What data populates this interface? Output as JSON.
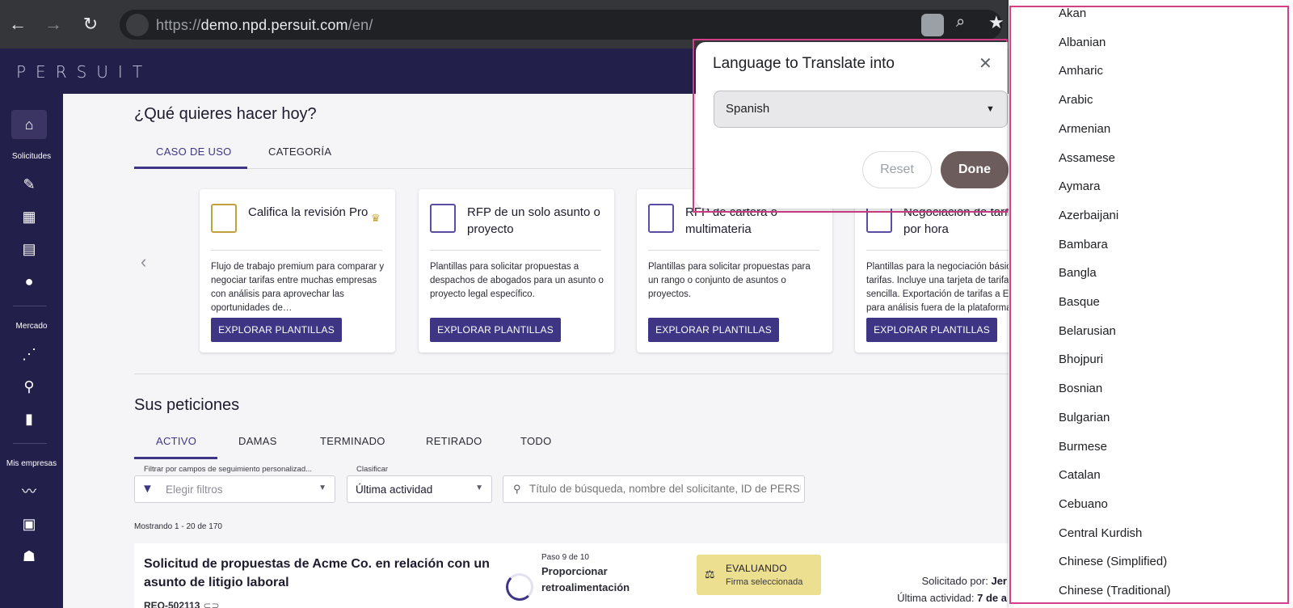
{
  "browser": {
    "url_scheme": "https://",
    "url_host": "demo.npd.persuit.com",
    "url_path": "/en/",
    "back_glyph": "←",
    "forward_glyph": "→",
    "reload_glyph": "↻"
  },
  "app": {
    "logo": "PERSUIT"
  },
  "sidebar": {
    "section_requests": "Solicitudes",
    "section_market": "Mercado",
    "section_firms": "Mis empresas"
  },
  "main": {
    "heading": "¿Qué quieres hacer hoy?",
    "tabs": [
      "CASO DE USO",
      "CATEGORÍA"
    ],
    "cards": [
      {
        "title": "Califica la revisión Pro",
        "desc": "Flujo de trabajo premium para comparar y negociar tarifas entre muchas empresas con análisis para aprovechar las oportunidades de…",
        "button": "EXPLORAR PLANTILLAS"
      },
      {
        "title": "RFP de un solo asunto o proyecto",
        "desc": "Plantillas para solicitar propuestas a despachos de abogados para un asunto o proyecto legal específico.",
        "button": "EXPLORAR PLANTILLAS"
      },
      {
        "title": "RFP de cartera o multimateria",
        "desc": "Plantillas para solicitar propuestas para un rango o conjunto de asuntos o proyectos.",
        "button": "EXPLORAR PLANTILLAS"
      },
      {
        "title": "Negociación de tarifas por hora",
        "desc": "Plantillas para la negociación básica de tarifas. Incluye una tarjeta de tarifas sencilla. Exportación de tarifas a Excel para análisis fuera de la plataforma.",
        "button": "EXPLORAR PLANTILLAS"
      }
    ],
    "requests_heading": "Sus peticiones",
    "request_tabs": [
      "ACTIVO",
      "DAMAS",
      "TERMINADO",
      "RETIRADO",
      "TODO"
    ],
    "filter_label": "Filtrar por campos de seguimiento personalizad...",
    "filter_placeholder": "Elegir filtros",
    "sort_label": "Clasificar",
    "sort_value": "Última actividad",
    "search_placeholder": "Título de búsqueda, nombre del solicitante, ID de PERSUIT",
    "showing": "Mostrando 1 - 20 de 170",
    "request": {
      "title": "Solicitud de propuestas de Acme Co. en relación con un asunto de litigio laboral",
      "id": "REQ-502113",
      "step": "Paso 9 de 10",
      "step_name": "Proporcionar retroalimentación",
      "status": "EVALUANDO",
      "status_sub": "Firma seleccionada",
      "requested_by_label": "Solicitado por:",
      "requested_by_value": "Jer",
      "last_activity_label": "Última actividad:",
      "last_activity_value": "7 de a"
    }
  },
  "translate_popup": {
    "title": "Language to Translate into",
    "selected": "Spanish",
    "reset": "Reset",
    "done": "Done"
  },
  "language_list": [
    "Akan",
    "Albanian",
    "Amharic",
    "Arabic",
    "Armenian",
    "Assamese",
    "Aymara",
    "Azerbaijani",
    "Bambara",
    "Bangla",
    "Basque",
    "Belarusian",
    "Bhojpuri",
    "Bosnian",
    "Bulgarian",
    "Burmese",
    "Catalan",
    "Cebuano",
    "Central Kurdish",
    "Chinese (Simplified)",
    "Chinese (Traditional)"
  ],
  "colors": {
    "brand": "#231f4b",
    "accent": "#3e3585",
    "highlight_outline": "#d63e8a",
    "status_badge": "#ecdf8f"
  }
}
